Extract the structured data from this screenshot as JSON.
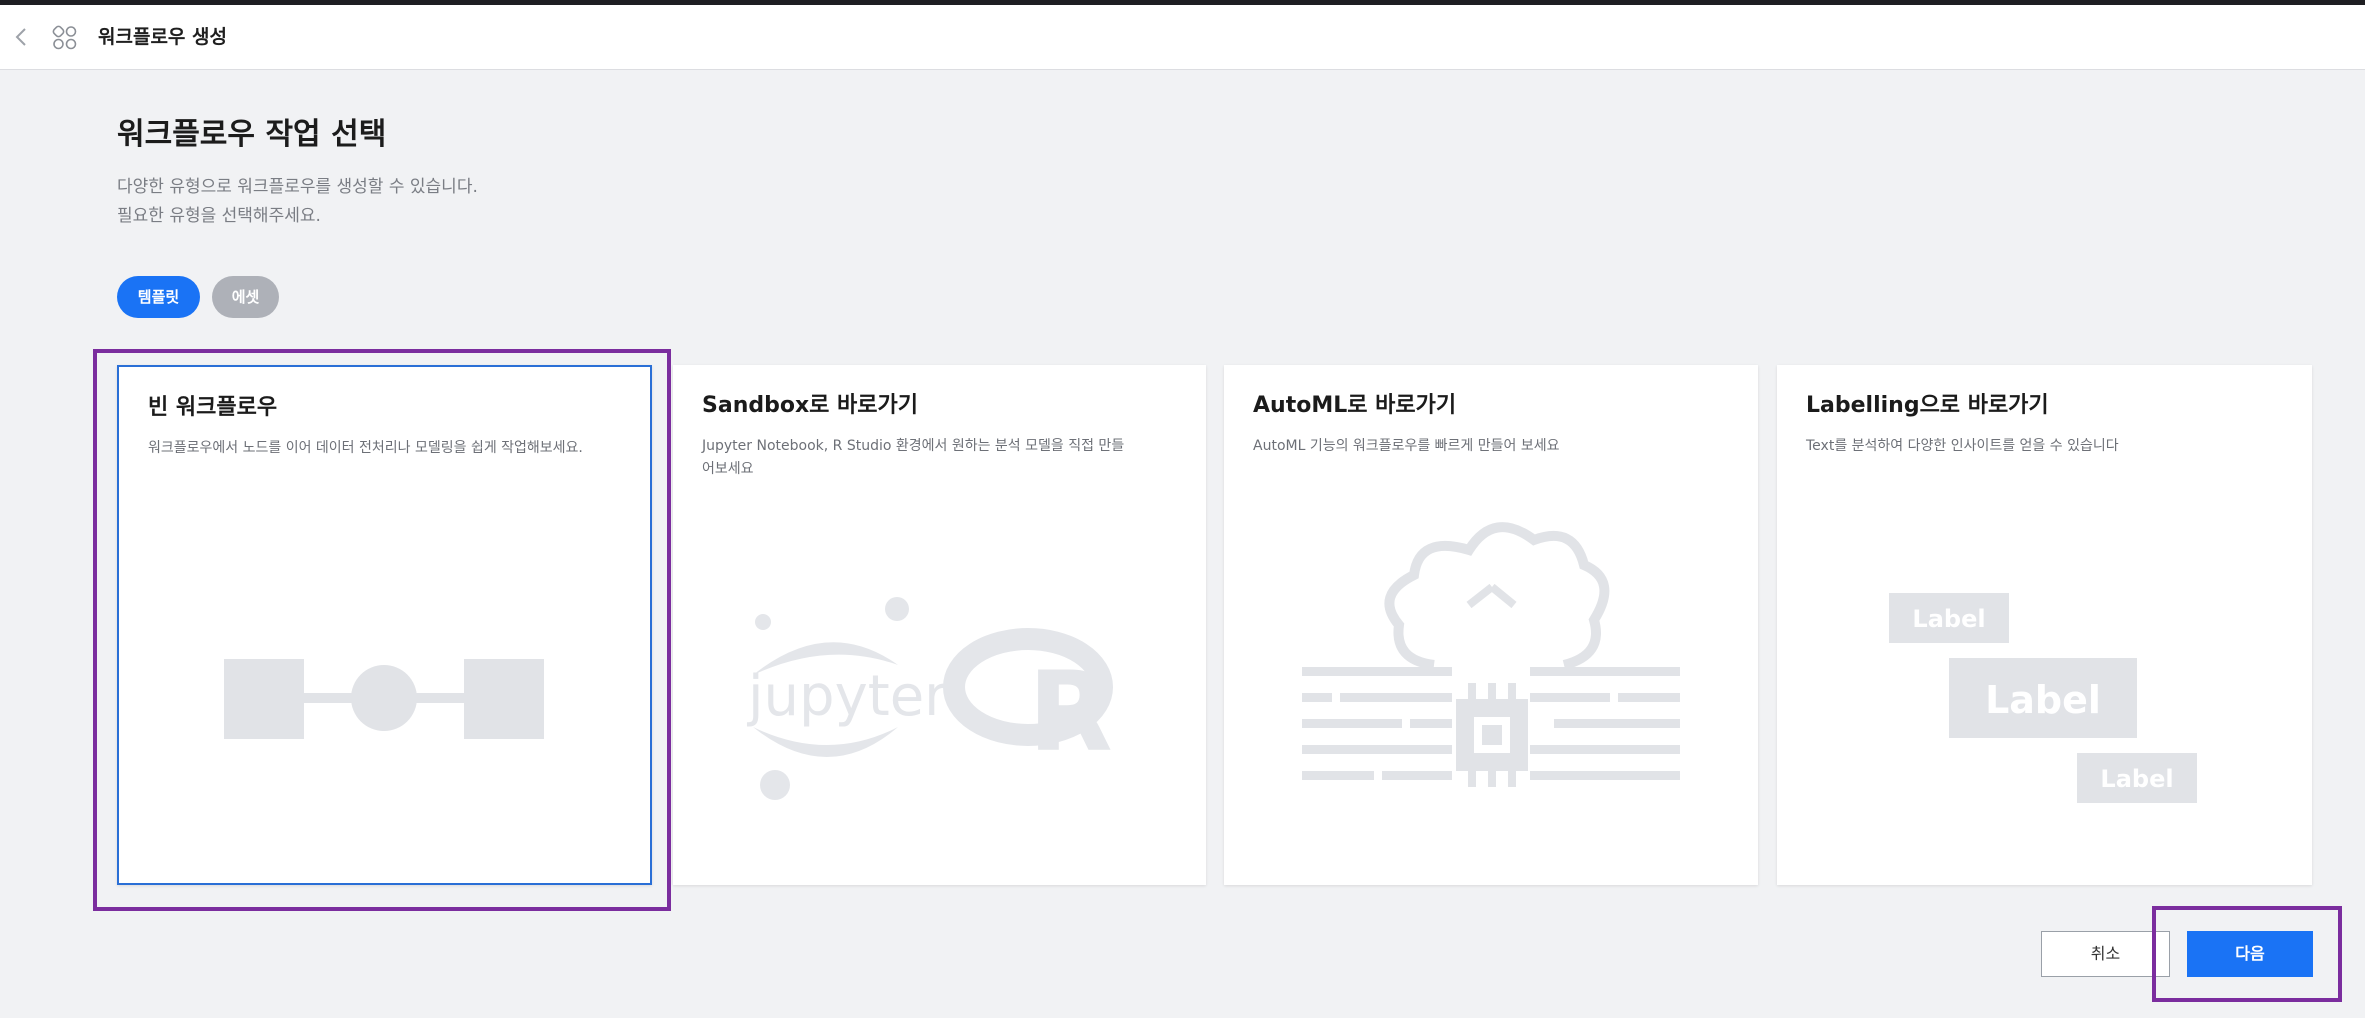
{
  "header": {
    "title": "워크플로우 생성",
    "back_icon": "chevron-left-icon",
    "apps_icon": "workflow-apps-icon"
  },
  "main": {
    "title": "워크플로우 작업 선택",
    "description_line1": "다양한 유형으로 워크플로우를 생성할 수 있습니다.",
    "description_line2": "필요한 유형을 선택해주세요."
  },
  "tabs": [
    {
      "label": "템플릿",
      "active": true,
      "color": "#1a73f5"
    },
    {
      "label": "에셋",
      "active": false,
      "color": "#aeb1b8"
    }
  ],
  "cards": [
    {
      "title": "빈 워크플로우",
      "description": "워크플로우에서 노드를 이어 데이터 전처리나 모델링을 쉽게 작업해보세요.",
      "illustration": "node-flow-illustration",
      "selected": true
    },
    {
      "title": "Sandbox로 바로가기",
      "description": "Jupyter Notebook, R Studio 환경에서 원하는 분석 모델을 직접 만들어보세요",
      "illustration": "jupyter-r-illustration",
      "art_text_jupyter": "jupyter",
      "art_text_r": "R",
      "selected": false
    },
    {
      "title": "AutoML로 바로가기",
      "description": "AutoML 기능의 워크플로우를 빠르게 만들어 보세요",
      "illustration": "cloud-chip-illustration",
      "selected": false
    },
    {
      "title": "Labelling으로 바로가기",
      "description": "Text를 분석하여 다양한 인사이트를 얻을 수 있습니다",
      "illustration": "label-tags-illustration",
      "art_labels": [
        "Label",
        "Label",
        "Label"
      ],
      "selected": false
    }
  ],
  "footer": {
    "cancel_label": "취소",
    "next_label": "다음"
  },
  "colors": {
    "accent": "#1a73f5",
    "highlight": "#7b2d9e",
    "illustration": "#e1e3e7"
  }
}
